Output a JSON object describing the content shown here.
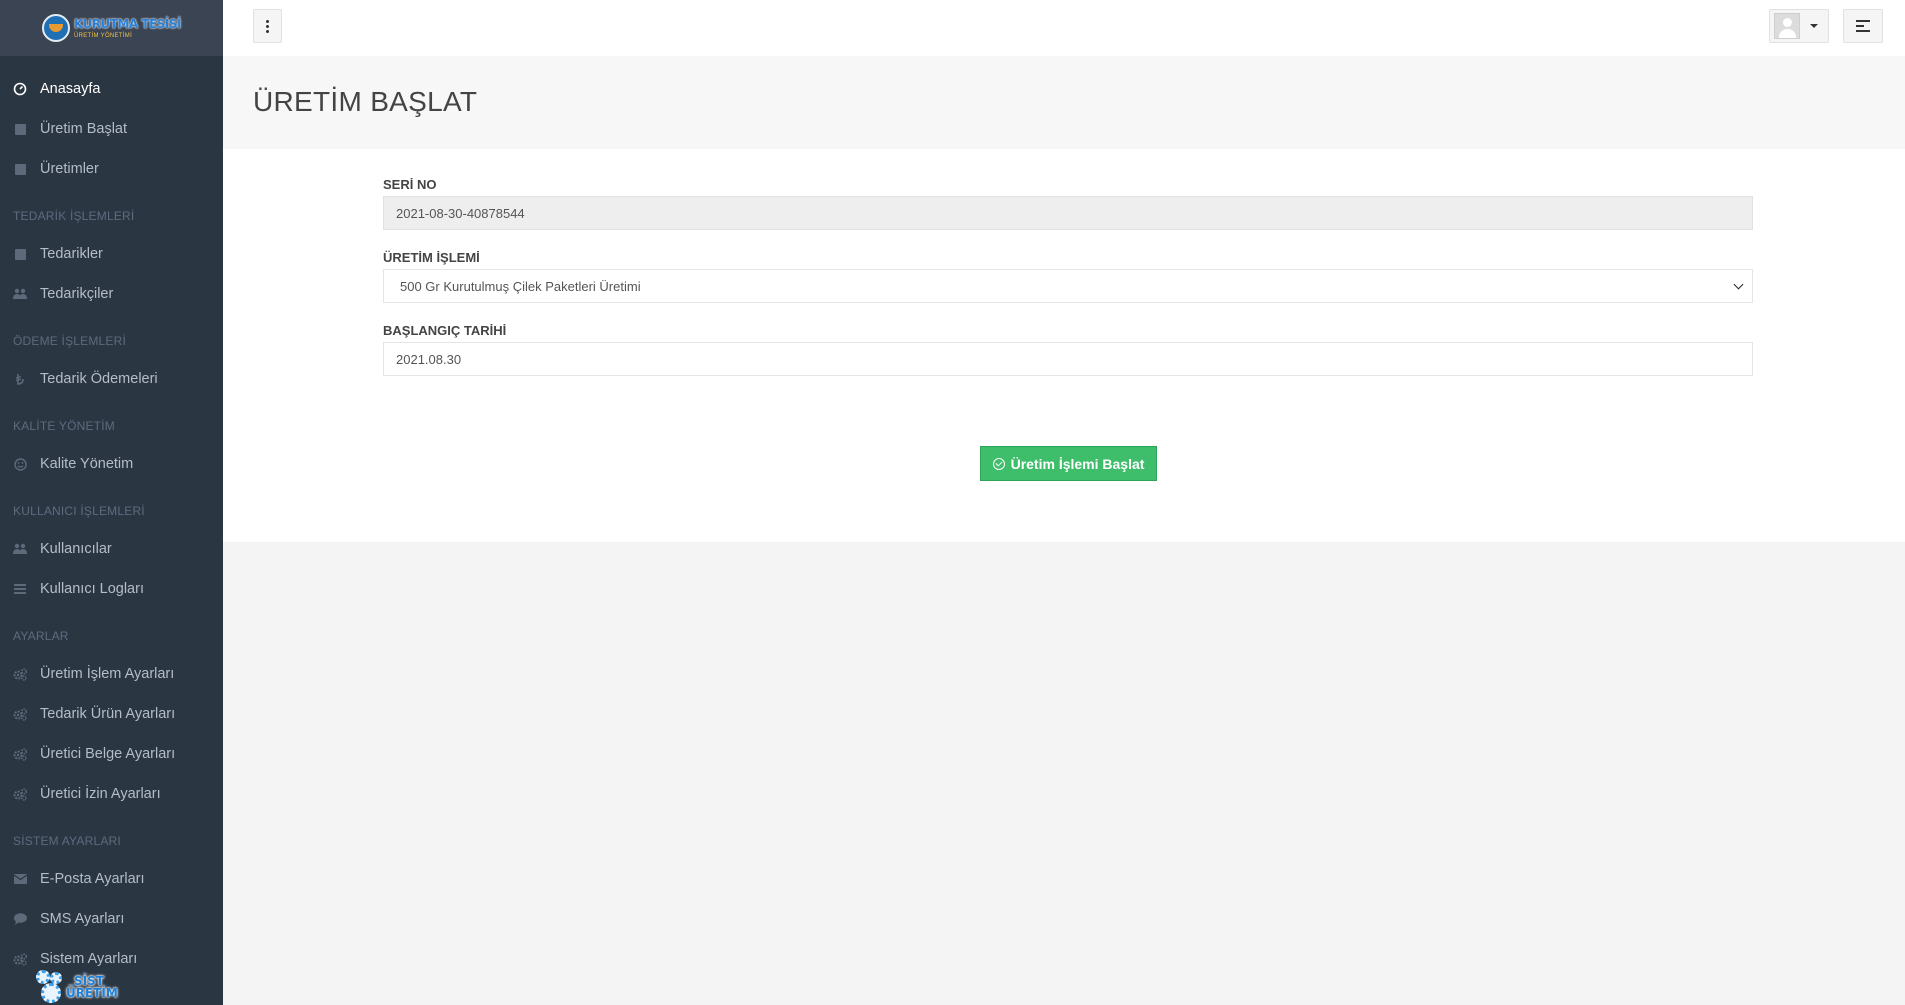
{
  "sidebar": {
    "brand": {
      "title": "KURUTMA TESİSİ",
      "subtitle": "ÜRETİM YÖNETİMİ"
    },
    "items": [
      {
        "label": "Anasayfa",
        "icon": "dashboard-icon",
        "active": true
      },
      {
        "label": "Üretim Başlat",
        "icon": "square-icon"
      },
      {
        "label": "Üretimler",
        "icon": "square-icon"
      },
      {
        "heading": "TEDARİK İŞLEMLERİ"
      },
      {
        "label": "Tedarikler",
        "icon": "square-icon"
      },
      {
        "label": "Tedarikçiler",
        "icon": "users-icon"
      },
      {
        "heading": "ÖDEME İŞLEMLERİ"
      },
      {
        "label": "Tedarik Ödemeleri",
        "icon": "lira-icon"
      },
      {
        "heading": "KALİTE YÖNETİM"
      },
      {
        "label": "Kalite Yönetim",
        "icon": "smile-icon"
      },
      {
        "heading": "KULLANICI İŞLEMLERİ"
      },
      {
        "label": "Kullanıcılar",
        "icon": "users-icon"
      },
      {
        "label": "Kullanıcı Logları",
        "icon": "list-icon"
      },
      {
        "heading": "AYARLAR"
      },
      {
        "label": "Üretim İşlem Ayarları",
        "icon": "gears-icon"
      },
      {
        "label": "Tedarik Ürün Ayarları",
        "icon": "gears-icon"
      },
      {
        "label": "Üretici Belge Ayarları",
        "icon": "gears-icon"
      },
      {
        "label": "Üretici İzin Ayarları",
        "icon": "gears-icon"
      },
      {
        "heading": "SİSTEM AYARLARI"
      },
      {
        "label": "E-Posta Ayarları",
        "icon": "envelope-icon"
      },
      {
        "label": "SMS Ayarları",
        "icon": "comment-icon"
      },
      {
        "label": "Sistem Ayarları",
        "icon": "gears-icon"
      }
    ],
    "footer_logo": {
      "line1": "SİST",
      "line2": "ÜRETİM"
    }
  },
  "header": {
    "user_avatar": "avatar-icon"
  },
  "page": {
    "title": "ÜRETİM BAŞLAT"
  },
  "form": {
    "serial_label": "SERİ NO",
    "serial_value": "2021-08-30-40878544",
    "process_label": "ÜRETİM İŞLEMİ",
    "process_value": "500 Gr Kurutulmuş Çilek Paketleri Üretimi",
    "start_label": "BAŞLANGIÇ TARİHİ",
    "start_value": "2021.08.30",
    "submit_label": "Üretim İşlemi Başlat"
  },
  "colors": {
    "sidebar_bg": "#2b3643",
    "submit_green": "#3ebd6b",
    "page_bg": "#f4f4f4"
  }
}
